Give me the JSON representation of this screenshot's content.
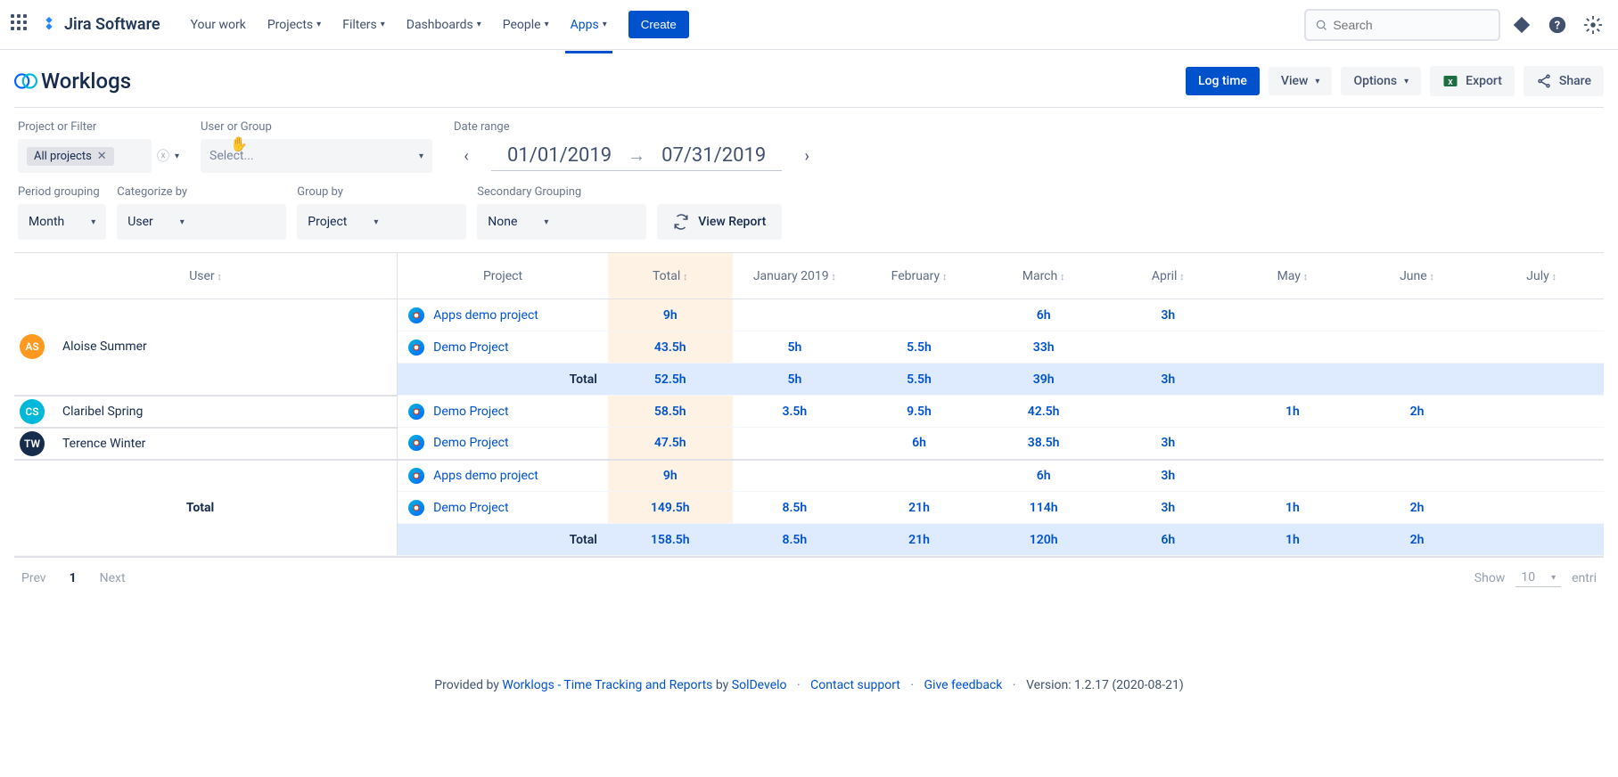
{
  "nav": {
    "product": "Jira Software",
    "items": [
      "Your work",
      "Projects",
      "Filters",
      "Dashboards",
      "People",
      "Apps"
    ],
    "active_index": 5,
    "create": "Create",
    "search_placeholder": "Search"
  },
  "header": {
    "title": "Worklogs",
    "actions": {
      "log_time": "Log time",
      "view": "View",
      "options": "Options",
      "export": "Export",
      "share": "Share"
    }
  },
  "filters": {
    "project_label": "Project or Filter",
    "project_chip": "All projects",
    "user_label": "User or Group",
    "user_placeholder": "Select...",
    "date_label": "Date range",
    "date_from": "01/01/2019",
    "date_to": "07/31/2019"
  },
  "groups": {
    "period_label": "Period grouping",
    "period_value": "Month",
    "categorize_label": "Categorize by",
    "categorize_value": "User",
    "groupby_label": "Group by",
    "groupby_value": "Project",
    "secondary_label": "Secondary Grouping",
    "secondary_value": "None",
    "view_report": "View Report"
  },
  "table": {
    "headers": {
      "user": "User",
      "project": "Project",
      "total": "Total",
      "months": [
        "January 2019",
        "February",
        "March",
        "April",
        "May",
        "June",
        "July"
      ]
    },
    "users": [
      {
        "name": "Aloise Summer",
        "initials": "AS",
        "color": "#ff991f",
        "rows": [
          {
            "project": "Apps demo project",
            "cells": [
              "9h",
              "",
              "",
              "6h",
              "3h",
              "",
              "",
              ""
            ]
          },
          {
            "project": "Demo Project",
            "cells": [
              "43.5h",
              "5h",
              "5.5h",
              "33h",
              "",
              "",
              "",
              ""
            ]
          }
        ],
        "subtotal_label": "Total",
        "subtotal": [
          "52.5h",
          "5h",
          "5.5h",
          "39h",
          "3h",
          "",
          "",
          ""
        ]
      },
      {
        "name": "Claribel Spring",
        "initials": "CS",
        "color": "#00b8d9",
        "rows": [
          {
            "project": "Demo Project",
            "cells": [
              "58.5h",
              "3.5h",
              "9.5h",
              "42.5h",
              "",
              "1h",
              "2h",
              ""
            ]
          }
        ]
      },
      {
        "name": "Terence Winter",
        "initials": "TW",
        "color": "#172b4d",
        "rows": [
          {
            "project": "Demo Project",
            "cells": [
              "47.5h",
              "",
              "6h",
              "38.5h",
              "3h",
              "",
              "",
              ""
            ]
          }
        ]
      }
    ],
    "grand_total_label": "Total",
    "grand_rows": [
      {
        "project": "Apps demo project",
        "cells": [
          "9h",
          "",
          "",
          "6h",
          "3h",
          "",
          "",
          ""
        ]
      },
      {
        "project": "Demo Project",
        "cells": [
          "149.5h",
          "8.5h",
          "21h",
          "114h",
          "3h",
          "1h",
          "2h",
          ""
        ]
      }
    ],
    "grand_subtotal_label": "Total",
    "grand_subtotal": [
      "158.5h",
      "8.5h",
      "21h",
      "120h",
      "6h",
      "1h",
      "2h",
      ""
    ]
  },
  "pager": {
    "prev": "Prev",
    "current": "1",
    "next": "Next",
    "show": "Show",
    "entries_value": "10",
    "entries_suffix": "entri"
  },
  "footer": {
    "provided": "Provided by",
    "app_link": "Worklogs - Time Tracking and Reports",
    "by": "by",
    "vendor": "SolDevelo",
    "support": "Contact support",
    "feedback": "Give feedback",
    "version": "Version: 1.2.17 (2020-08-21)"
  }
}
